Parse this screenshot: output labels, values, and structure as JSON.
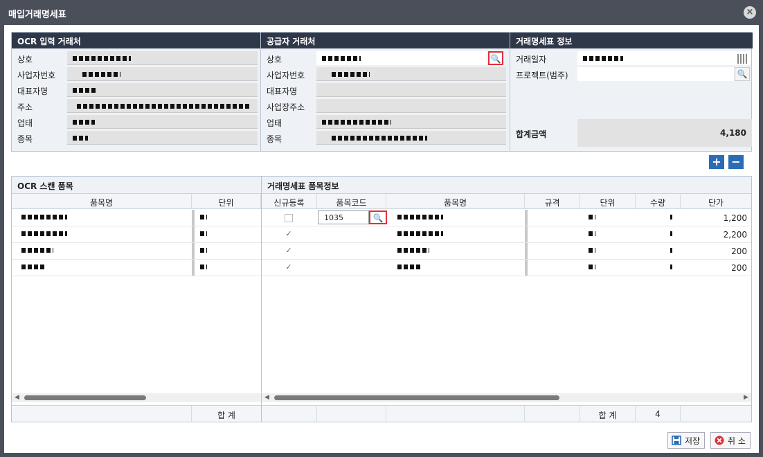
{
  "window": {
    "title": "매입거래명세표"
  },
  "ocr_vendor": {
    "header": "OCR 입력 거래처",
    "fields": [
      {
        "label": "상호"
      },
      {
        "label": "사업자번호"
      },
      {
        "label": "대표자명"
      },
      {
        "label": "주소"
      },
      {
        "label": "업태"
      },
      {
        "label": "종목"
      }
    ]
  },
  "supplier_vendor": {
    "header": "공급자 거래처",
    "fields": [
      {
        "label": "상호"
      },
      {
        "label": "사업자번호"
      },
      {
        "label": "대표자명"
      },
      {
        "label": "사업장주소"
      },
      {
        "label": "업태"
      },
      {
        "label": "종목"
      }
    ]
  },
  "invoice_info": {
    "header": "거래명세표 정보",
    "date_label": "거래일자",
    "project_label": "프로젝트(범주)",
    "total_label": "합계금액",
    "total_value": "4,180"
  },
  "ocr_items": {
    "header": "OCR 스캔 품목",
    "columns": [
      "품목명",
      "단위"
    ],
    "rows": 4,
    "sum_label": "합 계"
  },
  "invoice_items": {
    "header": "거래명세표 품목정보",
    "columns": [
      "신규등록",
      "품목코드",
      "품목명",
      "규격",
      "단위",
      "수량",
      "단가"
    ],
    "rows": [
      {
        "checked": false,
        "code": "1035",
        "price": "1,200"
      },
      {
        "checked": true,
        "code": "",
        "price": "2,200"
      },
      {
        "checked": true,
        "code": "",
        "price": "200"
      },
      {
        "checked": true,
        "code": "",
        "price": "200"
      }
    ],
    "sum_label": "합 계",
    "sum_qty": "4"
  },
  "buttons": {
    "save": "저장",
    "cancel": "취 소",
    "add": "+",
    "remove": "−"
  },
  "colors": {
    "header_bg": "#2f3849",
    "accent_blue": "#2b6cb5",
    "highlight_red": "#e0303a"
  }
}
